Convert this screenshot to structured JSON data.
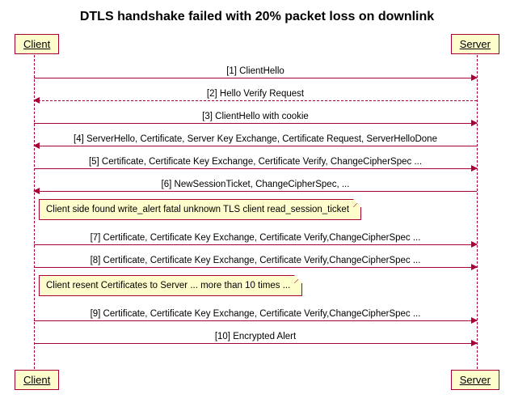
{
  "title": "DTLS handshake failed with 20% packet loss on downlink",
  "participants": {
    "left": "Client",
    "right": "Server"
  },
  "messages": [
    {
      "dir": "r",
      "style": "solid",
      "text": "[1] ClientHello"
    },
    {
      "dir": "l",
      "style": "dashed",
      "text": "[2] Hello Verify Request"
    },
    {
      "dir": "r",
      "style": "solid",
      "text": "[3] ClientHello with cookie"
    },
    {
      "dir": "l",
      "style": "solid",
      "text": "[4] ServerHello, Certificate, Server Key Exchange, Certificate Request, ServerHelloDone"
    },
    {
      "dir": "r",
      "style": "solid",
      "text": "[5] Certificate, Certificate Key Exchange, Certificate Verify, ChangeCipherSpec ..."
    },
    {
      "dir": "l",
      "style": "solid",
      "text": "[6] NewSessionTicket, ChangeCipherSpec, ..."
    },
    {
      "dir": "r",
      "style": "solid",
      "text": "[7] Certificate,  Certificate Key Exchange, Certificate Verify,ChangeCipherSpec ..."
    },
    {
      "dir": "r",
      "style": "solid",
      "text": "[8] Certificate,  Certificate Key Exchange, Certificate Verify,ChangeCipherSpec ..."
    },
    {
      "dir": "r",
      "style": "solid",
      "text": "[9] Certificate,  Certificate Key Exchange, Certificate Verify,ChangeCipherSpec ..."
    },
    {
      "dir": "r",
      "style": "solid",
      "text": "[10] Encrypted Alert"
    }
  ],
  "notes": [
    {
      "text": "Client side found write_alert fatal unknown TLS client read_session_ticket"
    },
    {
      "text": "Client resent Certificates to Server ... more than 10 times ..."
    }
  ],
  "chart_data": {
    "type": "sequence-diagram",
    "title": "DTLS handshake failed with 20% packet loss on downlink",
    "participants": [
      "Client",
      "Server"
    ],
    "events": [
      {
        "kind": "message",
        "from": "Client",
        "to": "Server",
        "label": "[1] ClientHello",
        "line": "solid"
      },
      {
        "kind": "message",
        "from": "Server",
        "to": "Client",
        "label": "[2] Hello Verify Request",
        "line": "dashed"
      },
      {
        "kind": "message",
        "from": "Client",
        "to": "Server",
        "label": "[3] ClientHello with cookie",
        "line": "solid"
      },
      {
        "kind": "message",
        "from": "Server",
        "to": "Client",
        "label": "[4] ServerHello, Certificate, Server Key Exchange, Certificate Request, ServerHelloDone",
        "line": "solid"
      },
      {
        "kind": "message",
        "from": "Client",
        "to": "Server",
        "label": "[5] Certificate, Certificate Key Exchange, Certificate Verify, ChangeCipherSpec ...",
        "line": "solid"
      },
      {
        "kind": "message",
        "from": "Server",
        "to": "Client",
        "label": "[6] NewSessionTicket, ChangeCipherSpec, ...",
        "line": "solid"
      },
      {
        "kind": "note",
        "over": "Client",
        "text": "Client side found write_alert fatal unknown TLS client read_session_ticket"
      },
      {
        "kind": "message",
        "from": "Client",
        "to": "Server",
        "label": "[7] Certificate,  Certificate Key Exchange, Certificate Verify,ChangeCipherSpec ...",
        "line": "solid"
      },
      {
        "kind": "message",
        "from": "Client",
        "to": "Server",
        "label": "[8] Certificate,  Certificate Key Exchange, Certificate Verify,ChangeCipherSpec ...",
        "line": "solid"
      },
      {
        "kind": "note",
        "over": "Client",
        "text": "Client resent Certificates to Server ... more than 10 times ..."
      },
      {
        "kind": "message",
        "from": "Client",
        "to": "Server",
        "label": "[9] Certificate,  Certificate Key Exchange, Certificate Verify,ChangeCipherSpec ...",
        "line": "solid"
      },
      {
        "kind": "message",
        "from": "Client",
        "to": "Server",
        "label": "[10] Encrypted Alert",
        "line": "solid"
      }
    ]
  }
}
